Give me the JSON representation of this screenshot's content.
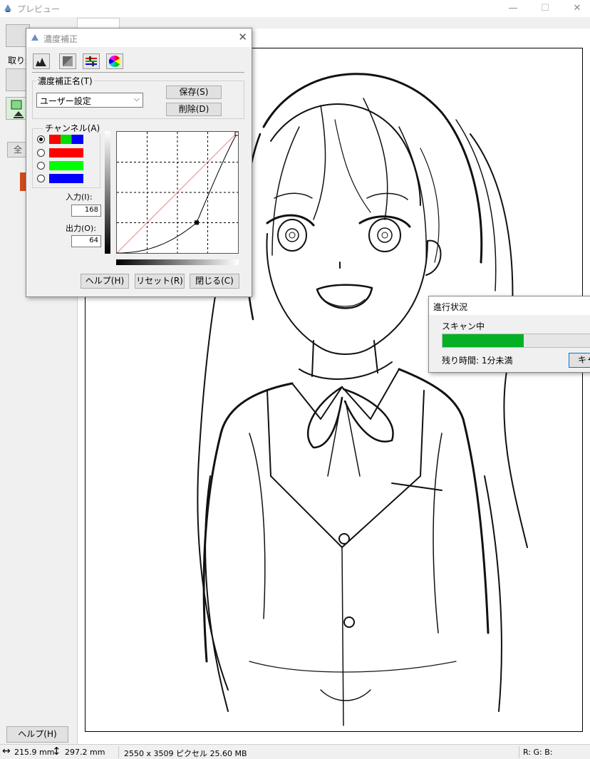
{
  "main_window": {
    "title": "プレビュー",
    "controls": {
      "minimize": "—",
      "maximize": "☐",
      "close": "✕"
    }
  },
  "left_panel": {
    "capture_label": "取り込",
    "zoom_button": "全",
    "help_button": "ヘルプ(H)"
  },
  "status_bar": {
    "width": "215.9 mm",
    "height": "297.2 mm",
    "resolution_info": "2550 x 3509 ピクセル 25.60 MB",
    "rgb": "R: G: B:"
  },
  "density_dialog": {
    "title": "濃度補正",
    "preset_group_label": "濃度補正名(T)",
    "preset_value": "ユーザー設定",
    "save_button": "保存(S)",
    "delete_button": "削除(D)",
    "channel_group_label": "チャンネル(A)",
    "channels": [
      {
        "name": "rgb",
        "selected": true,
        "colors": [
          "#ff0000",
          "#00dd00",
          "#0000ff"
        ]
      },
      {
        "name": "red",
        "selected": false,
        "colors": [
          "#ff0000"
        ]
      },
      {
        "name": "green",
        "selected": false,
        "colors": [
          "#00ff00"
        ]
      },
      {
        "name": "blue",
        "selected": false,
        "colors": [
          "#0000ff"
        ]
      }
    ],
    "input_label": "入力(I):",
    "input_value": "168",
    "output_label": "出力(O):",
    "output_value": "64",
    "help_button": "ヘルプ(H)",
    "reset_button": "リセット(R)",
    "close_button": "閉じる(C)",
    "curve": {
      "control_point": {
        "input": 168,
        "output": 64
      },
      "reference_line_color": "#ff8080"
    },
    "tab_icons": [
      "histogram-icon",
      "tone-icon",
      "balance-icon",
      "color-wheel-icon"
    ]
  },
  "progress_dialog": {
    "title": "進行状況",
    "status": "スキャン中",
    "progress": 0.5,
    "remaining": "残り時間: 1分未満",
    "cancel_button": "キャンセル",
    "bar_color": "#06b025"
  }
}
